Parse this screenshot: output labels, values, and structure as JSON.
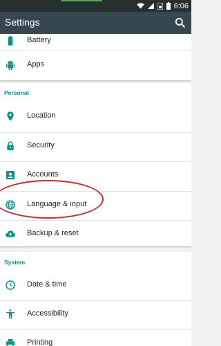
{
  "status_bar": {
    "time": "6:06",
    "icons": [
      "wifi-icon",
      "signal-icon",
      "sim-icon",
      "battery-icon"
    ]
  },
  "toolbar": {
    "title": "Settings",
    "search_icon": "search-icon"
  },
  "top_card": {
    "items": [
      {
        "label": "Battery",
        "icon": "battery-icon"
      },
      {
        "label": "Apps",
        "icon": "android-icon"
      }
    ]
  },
  "personal": {
    "header": "Personal",
    "items": [
      {
        "label": "Location",
        "icon": "location-pin-icon"
      },
      {
        "label": "Security",
        "icon": "lock-icon"
      },
      {
        "label": "Accounts",
        "icon": "account-box-icon"
      },
      {
        "label": "Language & input",
        "icon": "globe-icon"
      },
      {
        "label": "Backup & reset",
        "icon": "cloud-upload-icon"
      }
    ]
  },
  "system": {
    "header": "System",
    "items": [
      {
        "label": "Date & time",
        "icon": "clock-icon"
      },
      {
        "label": "Accessibility",
        "icon": "accessibility-icon"
      },
      {
        "label": "Printing",
        "icon": "print-icon"
      }
    ]
  },
  "colors": {
    "accent": "#009688",
    "toolbar": "#37474f",
    "status_bar": "#26312f",
    "annotation": "#d9232a"
  }
}
